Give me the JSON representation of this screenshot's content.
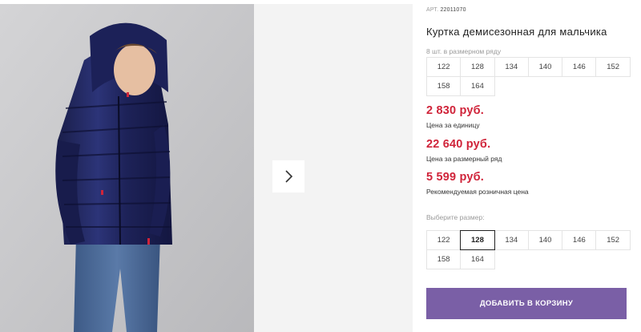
{
  "gallery": {
    "photo_alt": "",
    "next_icon": "chevron-right-icon"
  },
  "product": {
    "article_prefix": "АРТ.",
    "article_code": "22011070",
    "title": "Куртка демисезонная для мальчика",
    "size_row_label": "8 шт. в размерном ряду",
    "size_row": [
      "122",
      "128",
      "134",
      "140",
      "146",
      "152",
      "158",
      "164"
    ]
  },
  "prices": [
    {
      "value": "2 830 руб.",
      "label": "Цена за единицу"
    },
    {
      "value": "22 640 руб.",
      "label": "Цена за размерный ряд"
    },
    {
      "value": "5 599 руб.",
      "label": "Рекомендуемая розничная цена"
    }
  ],
  "size_picker": {
    "label": "Выберите размер:",
    "sizes": [
      "122",
      "128",
      "134",
      "140",
      "146",
      "152",
      "158",
      "164"
    ],
    "selected": "128"
  },
  "cart": {
    "button_label": "ДОБАВИТЬ В КОРЗИНУ"
  },
  "colors": {
    "price": "#d0243a",
    "button": "#7a5fa6",
    "gallery_bg": "#f3f3f3"
  }
}
